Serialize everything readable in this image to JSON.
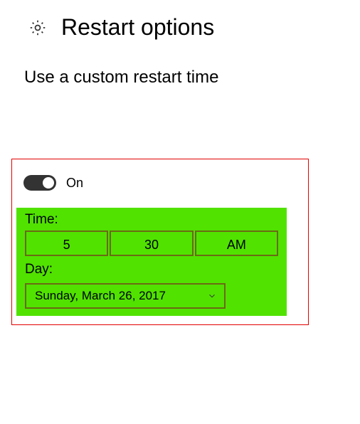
{
  "header": {
    "title": "Restart options"
  },
  "subtitle": "Use a custom restart time",
  "toggle": {
    "state_label": "On"
  },
  "time": {
    "label": "Time:",
    "hour": "5",
    "minute": "30",
    "period": "AM"
  },
  "day": {
    "label": "Day:",
    "value": "Sunday, March 26, 2017"
  },
  "colors": {
    "highlight_border": "#e40000",
    "panel_bg": "#51e200",
    "cell_border": "#6a6a14",
    "toggle_bg": "#333333"
  }
}
